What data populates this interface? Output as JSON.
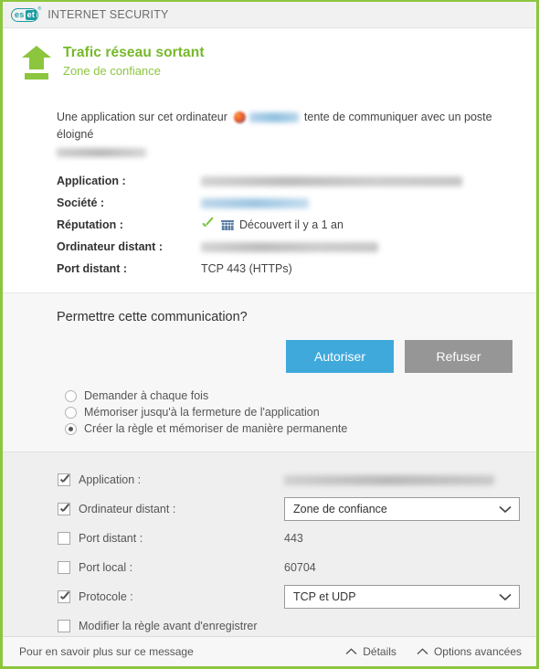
{
  "titlebar": {
    "logo_es": "es",
    "logo_et": "et",
    "logo_tm": "®",
    "suite_name": "INTERNET SECURITY"
  },
  "header": {
    "icon": "outgoing-traffic-arrow-icon",
    "title": "Trafic réseau sortant",
    "subtitle": "Zone de confiance"
  },
  "info": {
    "intro_before": "Une application sur cet ordinateur",
    "intro_after": "tente de communiquer avec un poste éloigné",
    "app_icon": "application-icon",
    "app_name_redacted": "",
    "remote_host_redacted": "",
    "rows": [
      {
        "key": "Application :",
        "value": "",
        "redacted": true
      },
      {
        "key": "Société :",
        "value": "",
        "redacted": true
      },
      {
        "key": "Réputation :",
        "value": "Découvert il y a 1 an",
        "redacted": false
      },
      {
        "key": "Ordinateur distant :",
        "value": "",
        "redacted": true
      },
      {
        "key": "Port distant :",
        "value": "TCP 443 (HTTPs)",
        "redacted": false
      }
    ],
    "reputation": {
      "check_icon": "green-check-icon",
      "people_icon": "users-group-icon",
      "text": "Découvert il y a 1 an"
    }
  },
  "ask": {
    "title": "Permettre cette communication?",
    "allow_label": "Autoriser",
    "deny_label": "Refuser",
    "allow_color": "#3fa9dc",
    "deny_color": "#969696",
    "radios": [
      {
        "label": "Demander à chaque fois",
        "selected": false
      },
      {
        "label": "Mémoriser jusqu'à la fermeture de l'application",
        "selected": false
      },
      {
        "label": "Créer la règle et mémoriser de manière permanente",
        "selected": true
      }
    ]
  },
  "rule": {
    "options": [
      {
        "label": "Application :",
        "checked": true,
        "type": "redacted",
        "value": ""
      },
      {
        "label": "Ordinateur distant :",
        "checked": true,
        "type": "combo",
        "value": "Zone de confiance"
      },
      {
        "label": "Port distant :",
        "checked": false,
        "type": "text",
        "value": "443"
      },
      {
        "label": "Port local :",
        "checked": false,
        "type": "text",
        "value": "60704"
      },
      {
        "label": "Protocole :",
        "checked": true,
        "type": "combo",
        "value": "TCP et UDP"
      },
      {
        "label": "Modifier la règle avant d'enregistrer",
        "checked": false,
        "type": "none",
        "value": ""
      }
    ]
  },
  "footer": {
    "more_info": "Pour en savoir plus sur ce message",
    "details": "Détails",
    "advanced": "Options avancées",
    "chevron_icon": "chevron-up-icon"
  },
  "colors": {
    "brand_green": "#8cc63e",
    "title_green": "#76b82a",
    "teal_logo": "#1a9ba1",
    "accent_blue": "#3fa9dc"
  }
}
